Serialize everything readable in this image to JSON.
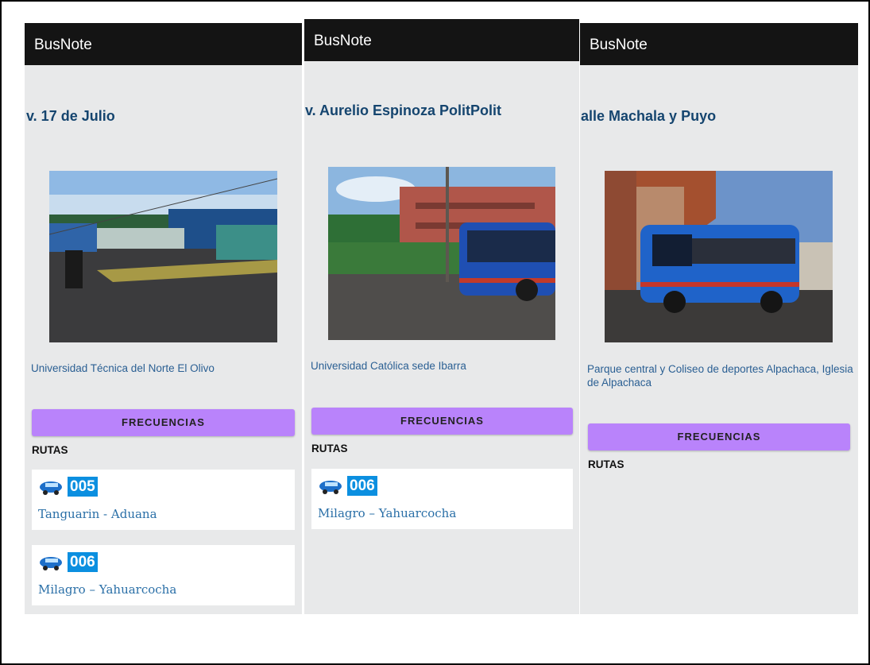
{
  "screens": [
    {
      "app_title": "BusNote",
      "stop_title": "v. 17 de Julio",
      "description": "Universidad Técnica del Norte El Olivo",
      "freq_label": "FRECUENCIAS",
      "routes_label": "RUTAS",
      "routes": [
        {
          "number": "005",
          "name": "Tanguarin - Aduana"
        },
        {
          "number": "006",
          "name": "Milagro – Yahuarcocha"
        }
      ]
    },
    {
      "app_title": "BusNote",
      "stop_title": "v. Aurelio Espinoza PolitPolit",
      "description": "Universidad Católica sede Ibarra",
      "freq_label": "FRECUENCIAS",
      "routes_label": "RUTAS",
      "routes": [
        {
          "number": "006",
          "name": "Milagro – Yahuarcocha"
        }
      ]
    },
    {
      "app_title": "BusNote",
      "stop_title": "alle Machala y Puyo",
      "description": "Parque central y Coliseo de deportes Alpachaca, Iglesia de Alpachaca",
      "freq_label": "FRECUENCIAS",
      "routes_label": "RUTAS",
      "routes": []
    }
  ],
  "icons": {
    "route": "bus-icon"
  },
  "colors": {
    "appbar": "#141414",
    "button": "#b983fb",
    "title": "#15456f",
    "link": "#2a5f93",
    "badge": "#0b8fe0"
  }
}
